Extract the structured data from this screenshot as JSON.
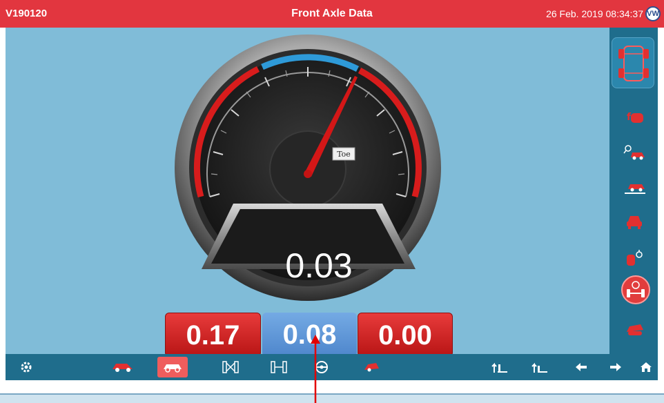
{
  "header": {
    "vehicle_id": "V190120",
    "title": "Front Axle Data",
    "datetime": "26 Feb. 2019 08:34:37"
  },
  "gauge": {
    "label": "Toe",
    "reading": "0.03"
  },
  "values": {
    "left": "0.17",
    "center": "0.08",
    "right": "0.00"
  },
  "sidebar": {
    "items": [
      "axle-layout-icon",
      "car-alert-icon",
      "car-search-icon",
      "car-lift-icon",
      "car-front-icon",
      "wheel-sensor-icon",
      "axle-wheel-icon",
      "car-tilt-icon"
    ],
    "active_index": 6
  },
  "toolbar": {
    "items": [
      "settings-icon",
      "car-side-icon",
      "car-rear-icon",
      "axle-cross-icon",
      "axle-h-icon",
      "steering-wheel-icon",
      "car-angle-icon",
      "lift-up-icon",
      "lift-down-icon",
      "arrow-left-icon",
      "arrow-right-icon",
      "home-icon"
    ],
    "active_index": 2
  },
  "colors": {
    "header": "#e2363f",
    "main_bg": "#80bcd8",
    "toolbar": "#1f6d8c",
    "value_red": "#d32222",
    "value_blue": "#5c97d8",
    "needle": "#d41717",
    "blue_band": "#2e9ad8"
  }
}
